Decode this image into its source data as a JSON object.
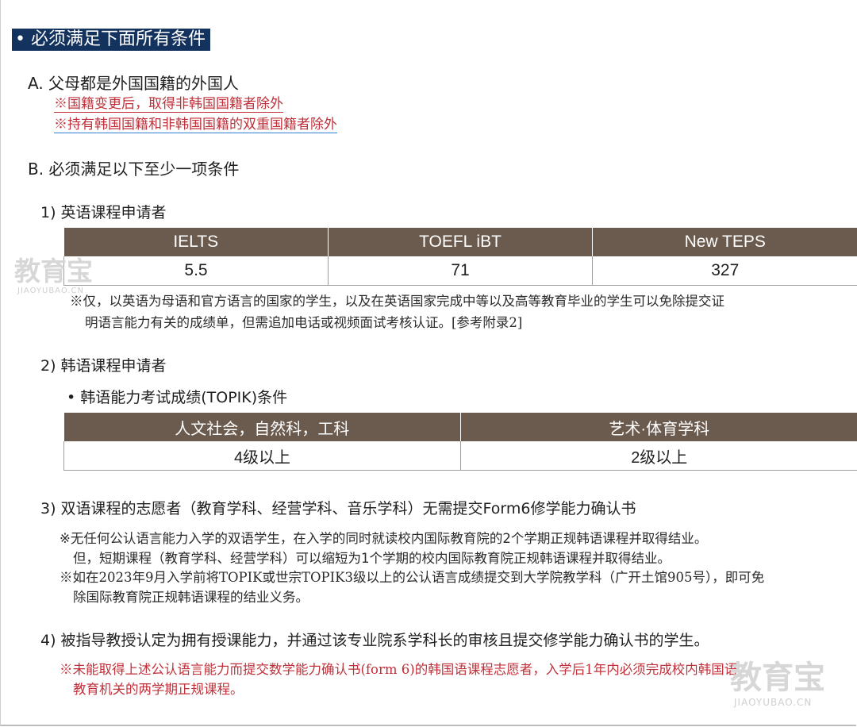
{
  "title": "• 必须满足下面所有条件",
  "sectionA": {
    "heading": "A. 父母都是外国国籍的外国人",
    "note1": "※国籍变更后，取得非韩国国籍者除外",
    "note2": "※持有韩国国籍和非韩国国籍的双重国籍者除外"
  },
  "sectionB": {
    "heading": "B. 必须满足以下至少一项条件"
  },
  "english": {
    "heading": "1) 英语课程申请者",
    "columns": [
      "IELTS",
      "TOEFL iBT",
      "New TEPS"
    ],
    "values": [
      "5.5",
      "71",
      "327"
    ],
    "note_line1": "※仅，以英语为母语和官方语言的国家的学生，以及在英语国家完成中等以及高等教育毕业的学生可以免除提交证",
    "note_line2": "明语言能力有关的成绩单，但需追加电话或视频面试考核认证。[参考附录2]"
  },
  "korean": {
    "heading": "2) 韩语课程申请者",
    "sub": "• 韩语能力考试成绩(TOPIK)条件",
    "columns": [
      "人文社会，自然科，工科",
      "艺术·体育学科"
    ],
    "values": [
      "4级以上",
      "2级以上"
    ]
  },
  "bilingual": {
    "heading": "3) 双语课程的志愿者（教育学科、经营学科、音乐学科）无需提交Form6修学能力确认书",
    "note1_line1": "※无任何公认语言能力入学的双语学生，在入学的同时就读校内国际教育院的2个学期正规韩语课程并取得结业。",
    "note1_line2": "但，短期课程（教育学科、经营学科）可以缩短为1个学期的校内国际教育院正规韩语课程并取得结业。",
    "note2_line1": "※如在2023年9月入学前将TOPIK或世宗TOPIK3级以上的公认语言成绩提交到大学院教学科（广开土馆905号），即可免",
    "note2_line2": "除国际教育院正规韩语课程的结业义务。"
  },
  "professor": {
    "heading": "4) 被指导教授认定为拥有授课能力，并通过该专业院系学科长的审核且提交修学能力确认书的学生。",
    "note_line1": "※未能取得上述公认语言能力而提交数学能力确认书(form 6)的韩国语课程志愿者，入学后1年内必须完成校内韩国语",
    "note_line2": "教育机关的两学期正规课程。"
  },
  "watermark": {
    "logo": "教育宝",
    "site": "JIAOYUBAO.CN"
  },
  "colors": {
    "title_bg": "#13325e",
    "table_header": "#6b5a4e",
    "red_note": "#c0303a",
    "blue_underline": "#2f7fd2"
  }
}
